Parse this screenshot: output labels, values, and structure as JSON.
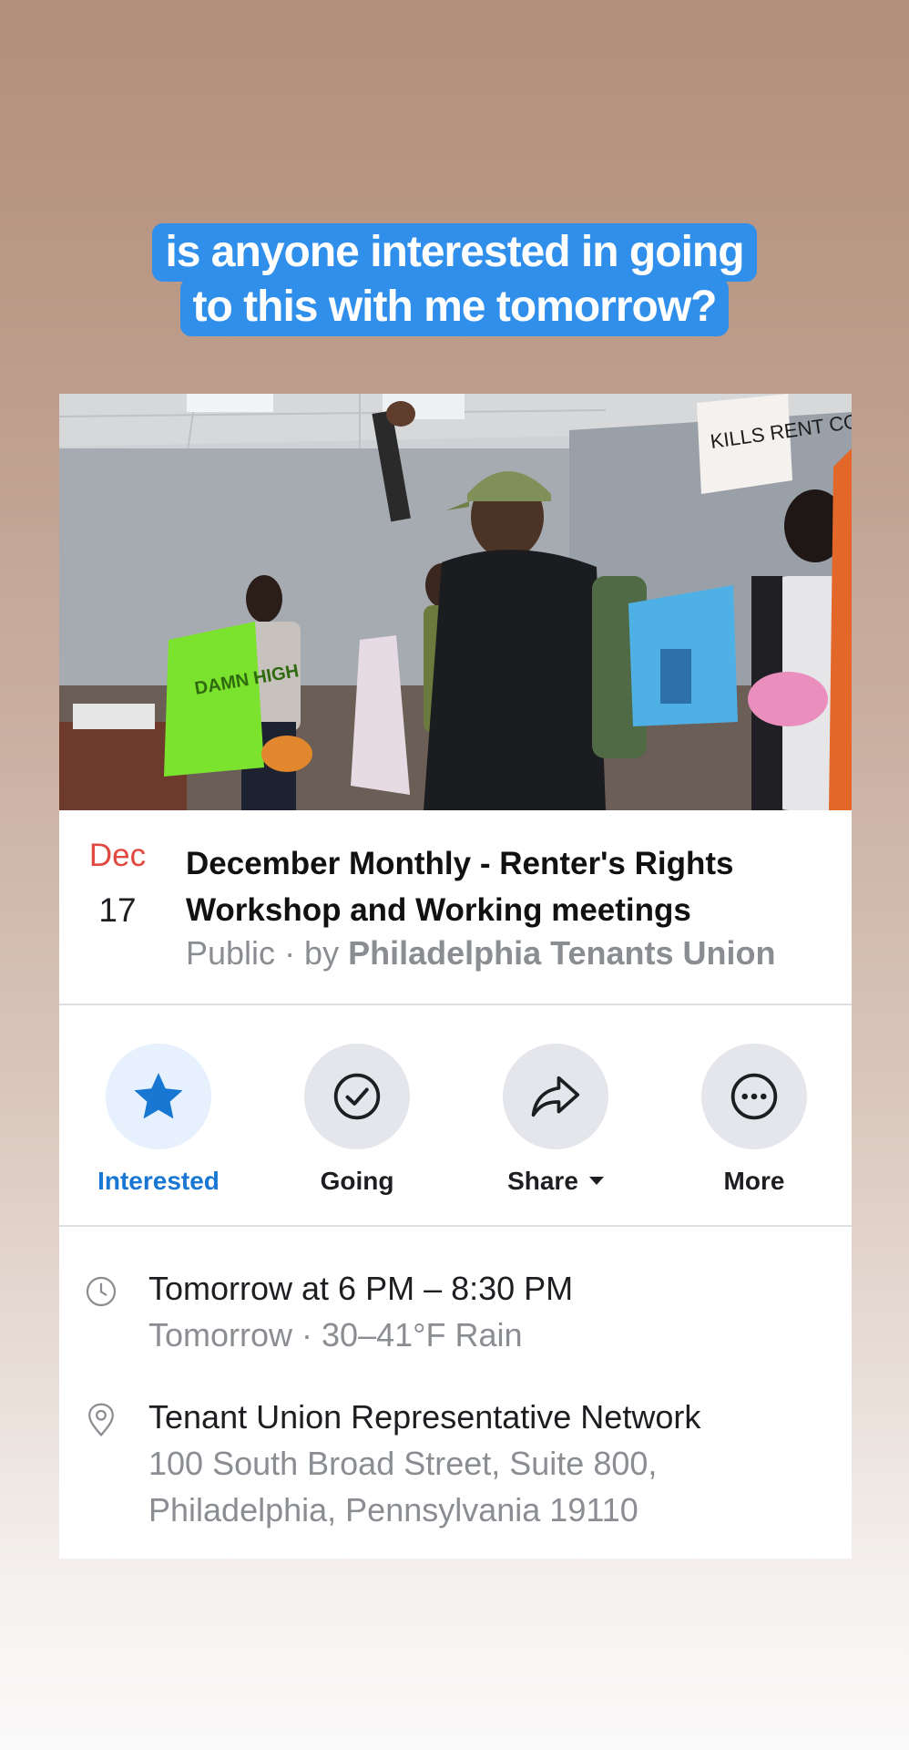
{
  "story": {
    "caption_lines": [
      "is anyone interested in going",
      "to this with me tomorrow?"
    ]
  },
  "event": {
    "date": {
      "month": "Dec",
      "day": "17"
    },
    "title_lines": [
      "December Monthly - Renter's Rights",
      "Workshop and Working meetings"
    ],
    "visibility": "Public",
    "by_prefix": " · by ",
    "host": "Philadelphia Tenants Union",
    "photo_sign_text": {
      "green_sign": "DAMN HIGH",
      "white_sign": "KILLS RENT CONTROL NOW"
    }
  },
  "actions": [
    {
      "label": "Interested",
      "icon": "star-icon",
      "active": true
    },
    {
      "label": "Going",
      "icon": "check-circle-icon",
      "active": false
    },
    {
      "label": "Share",
      "icon": "share-arrow-icon",
      "active": false,
      "has_dropdown": true
    },
    {
      "label": "More",
      "icon": "more-dots-icon",
      "active": false
    }
  ],
  "details": {
    "time": {
      "primary": "Tomorrow at 6 PM – 8:30 PM",
      "secondary": "Tomorrow · 30–41°F Rain",
      "icon": "clock-icon"
    },
    "location": {
      "name": "Tenant Union Representative Network",
      "address_line1": "100 South Broad Street, Suite 800,",
      "address_line2": "Philadelphia, Pennsylvania 19110",
      "icon": "location-pin-icon"
    }
  },
  "colors": {
    "caption_bg": "#2f8fea",
    "accent_blue": "#1877d2",
    "date_red": "#e0493f",
    "muted_text": "#8a8d91"
  }
}
